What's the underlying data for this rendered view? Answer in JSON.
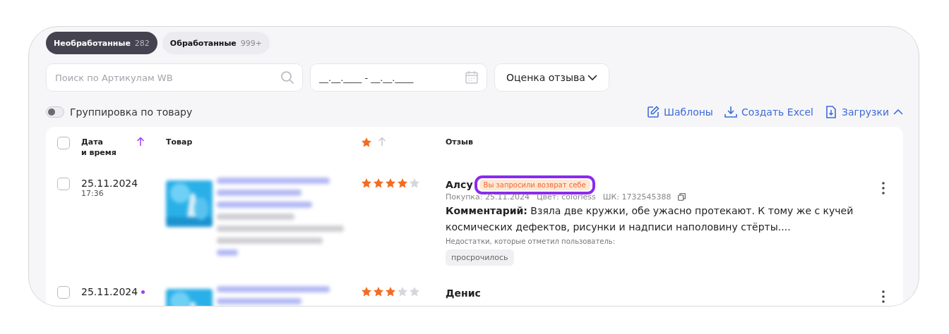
{
  "tabs": [
    {
      "label": "Необработанные",
      "count": "282",
      "selected": true
    },
    {
      "label": "Обработанные",
      "count": "999+",
      "selected": false
    }
  ],
  "search": {
    "placeholder": "Поиск по Артикулам WB"
  },
  "date_range": {
    "placeholder": "__.__.____ - __.__.____"
  },
  "rating_filter": {
    "label": "Оценка отзыва"
  },
  "group_toggle": {
    "label": "Группировка по товару",
    "on": false
  },
  "actions": [
    {
      "label": "Шаблоны",
      "kind": "edit"
    },
    {
      "label": "Создать Excel",
      "kind": "download"
    },
    {
      "label": "Загрузки",
      "kind": "file",
      "expanded": true
    }
  ],
  "table": {
    "select_all_checked": false,
    "columns": [
      {
        "label": "Дата\nи время",
        "sorted": true
      },
      {
        "label": "Товар"
      },
      {
        "kind": "rating",
        "sorted": false
      },
      {
        "label": "Отзыв"
      }
    ],
    "rows": [
      {
        "checked": false,
        "date": "25.11.2024",
        "time": "17:36",
        "unread": false,
        "stars": 4,
        "author": "Алсу",
        "badge": "Вы запросили возврат себе",
        "highlighted": true,
        "meta": [
          "Покупка: 25.11.2024",
          "Цвет: colorless",
          "ШК: 1732545388"
        ],
        "comment_label": "Комментарий:",
        "comment": "Взяла две кружки, обе ужасно протекают. К тому же с кучей космических дефектов, рисунки и надписи наполовину стёрты....",
        "defects_label": "Недостатки, которые отметил пользователь:",
        "defects": [
          "просрочилось"
        ]
      },
      {
        "checked": false,
        "date": "25.11.2024",
        "unread": true,
        "stars": 3,
        "author": "Денис"
      }
    ]
  }
}
